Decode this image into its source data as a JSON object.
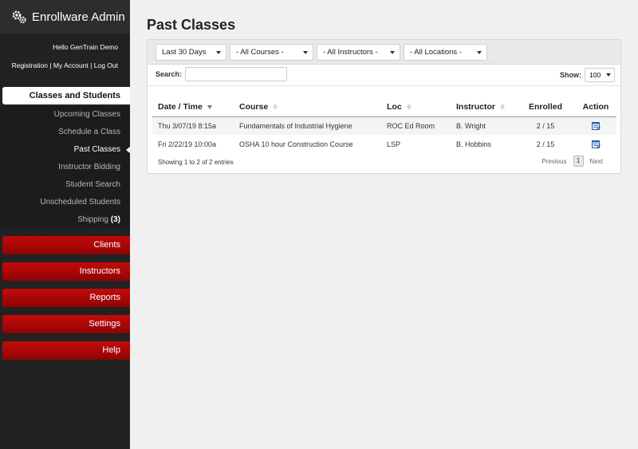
{
  "sidebar": {
    "brand": {
      "title": "Enrollware Admin",
      "icon": "gears-icon"
    },
    "greeting": "Hello GenTrain Demo",
    "links": {
      "registration": "Registration",
      "sep1": " | ",
      "my_account": "My Account",
      "sep2": " | ",
      "logout": "Log Out"
    },
    "section": "Classes and Students",
    "sub_items": [
      {
        "label": "Upcoming Classes"
      },
      {
        "label": "Schedule a Class"
      },
      {
        "label": "Past Classes",
        "active": true
      },
      {
        "label": "Instructor Bidding"
      },
      {
        "label": "Student Search"
      },
      {
        "label": "Unscheduled Students"
      },
      {
        "label": "Shipping",
        "count": "(3)"
      }
    ],
    "nav": [
      "Clients",
      "Instructors",
      "Reports",
      "Settings",
      "Help"
    ],
    "colors": {
      "bg": "#222222",
      "red": "#b00606"
    }
  },
  "main": {
    "title": "Past Classes",
    "filters": {
      "date": "Last 30 Days",
      "courses": "- All Courses -",
      "instructors": "- All Instructors -",
      "locations": "- All Locations -"
    },
    "search": {
      "label": "Search:",
      "value": ""
    },
    "show": {
      "label": "Show:",
      "value": "100"
    },
    "table": {
      "columns": [
        "Date / Time",
        "Course",
        "Loc",
        "Instructor",
        "Enrolled",
        "Action"
      ],
      "rows": [
        {
          "datetime": "Thu 3/07/19 8:15a",
          "course": "Fundamentals of Industrial Hygiene",
          "loc": "ROC Ed Room",
          "instructor": "B. Wright",
          "enrolled": "2 / 15",
          "action_icon": "edit-icon"
        },
        {
          "datetime": "Fri 2/22/19 10:00a",
          "course": "OSHA 10 hour Construction Course",
          "loc": "LSP",
          "instructor": "B. Hobbins",
          "enrolled": "2 / 15",
          "action_icon": "edit-icon"
        }
      ]
    },
    "info": "Showing 1 to 2 of 2 entries",
    "pager": {
      "previous": "Previous",
      "current": "1",
      "next": "Next"
    }
  }
}
